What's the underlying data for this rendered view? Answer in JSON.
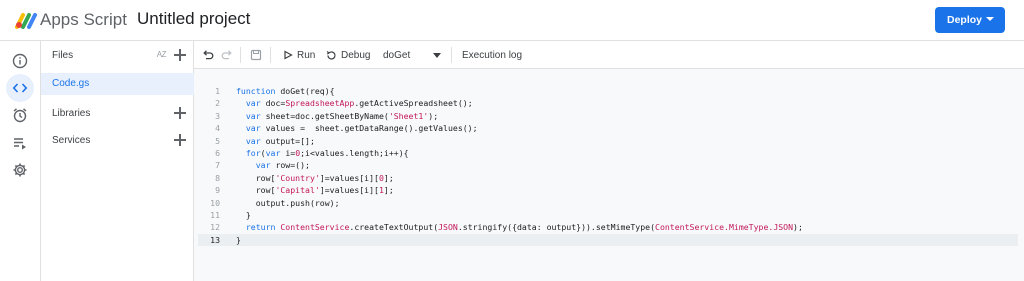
{
  "header": {
    "app_name": "Apps Script",
    "project_title": "Untitled project",
    "deploy_label": "Deploy",
    "brand_color": "#1a73e8"
  },
  "rail": {
    "items": [
      {
        "name": "overview",
        "icon": "info-icon",
        "active": false
      },
      {
        "name": "editor",
        "icon": "code-icon",
        "active": true
      },
      {
        "name": "triggers",
        "icon": "alarm-clock-icon",
        "active": false
      },
      {
        "name": "executions",
        "icon": "playlist-icon",
        "active": false
      },
      {
        "name": "settings",
        "icon": "gear-icon",
        "active": false
      }
    ]
  },
  "files_panel": {
    "files_label": "Files",
    "sort_label": "AZ",
    "files": [
      "Code.gs"
    ],
    "libraries_label": "Libraries",
    "services_label": "Services"
  },
  "toolbar": {
    "run_label": "Run",
    "debug_label": "Debug",
    "function_select": "doGet",
    "execution_log_label": "Execution log"
  },
  "editor": {
    "current_line": 13,
    "lines": [
      {
        "n": "1",
        "tokens": [
          [
            "kw",
            "function"
          ],
          [
            "p",
            " doGet(req){"
          ]
        ]
      },
      {
        "n": "2",
        "tokens": [
          [
            "p",
            "  "
          ],
          [
            "kw",
            "var"
          ],
          [
            "p",
            " doc="
          ],
          [
            "cls",
            "SpreadsheetApp"
          ],
          [
            "p",
            ".getActiveSpreadsheet();"
          ]
        ]
      },
      {
        "n": "3",
        "tokens": [
          [
            "p",
            "  "
          ],
          [
            "kw",
            "var"
          ],
          [
            "p",
            " sheet=doc.getSheetByName("
          ],
          [
            "str",
            "'Sheet1'"
          ],
          [
            "p",
            ");"
          ]
        ]
      },
      {
        "n": "4",
        "tokens": [
          [
            "p",
            "  "
          ],
          [
            "kw",
            "var"
          ],
          [
            "p",
            " values =  sheet.getDataRange().getValues();"
          ]
        ]
      },
      {
        "n": "5",
        "tokens": [
          [
            "p",
            "  "
          ],
          [
            "kw",
            "var"
          ],
          [
            "p",
            " output=[];"
          ]
        ]
      },
      {
        "n": "6",
        "tokens": [
          [
            "p",
            "  "
          ],
          [
            "kw",
            "for"
          ],
          [
            "p",
            "("
          ],
          [
            "kw",
            "var"
          ],
          [
            "p",
            " i="
          ],
          [
            "num",
            "0"
          ],
          [
            "p",
            ";i<values.length;i++){"
          ]
        ]
      },
      {
        "n": "7",
        "tokens": [
          [
            "p",
            "    "
          ],
          [
            "kw",
            "var"
          ],
          [
            "p",
            " row=();"
          ]
        ]
      },
      {
        "n": "8",
        "tokens": [
          [
            "p",
            "    row["
          ],
          [
            "str",
            "'Country'"
          ],
          [
            "p",
            "]=values[i]["
          ],
          [
            "num",
            "0"
          ],
          [
            "p",
            "];"
          ]
        ]
      },
      {
        "n": "9",
        "tokens": [
          [
            "p",
            "    row["
          ],
          [
            "str",
            "'Capital'"
          ],
          [
            "p",
            "]=values[i]["
          ],
          [
            "num",
            "1"
          ],
          [
            "p",
            "];"
          ]
        ]
      },
      {
        "n": "10",
        "tokens": [
          [
            "p",
            "    output.push(row);"
          ]
        ]
      },
      {
        "n": "11",
        "tokens": [
          [
            "p",
            "  }"
          ]
        ]
      },
      {
        "n": "12",
        "tokens": [
          [
            "p",
            "  "
          ],
          [
            "kw",
            "return"
          ],
          [
            "p",
            " "
          ],
          [
            "cls",
            "ContentService"
          ],
          [
            "p",
            ".createTextOutput("
          ],
          [
            "cls",
            "JSON"
          ],
          [
            "p",
            ".stringify({data: output})).setMimeType("
          ],
          [
            "cls",
            "ContentService.MimeType.JSON"
          ],
          [
            "p",
            ");"
          ]
        ]
      },
      {
        "n": "13",
        "tokens": [
          [
            "p",
            "}"
          ]
        ]
      }
    ]
  }
}
